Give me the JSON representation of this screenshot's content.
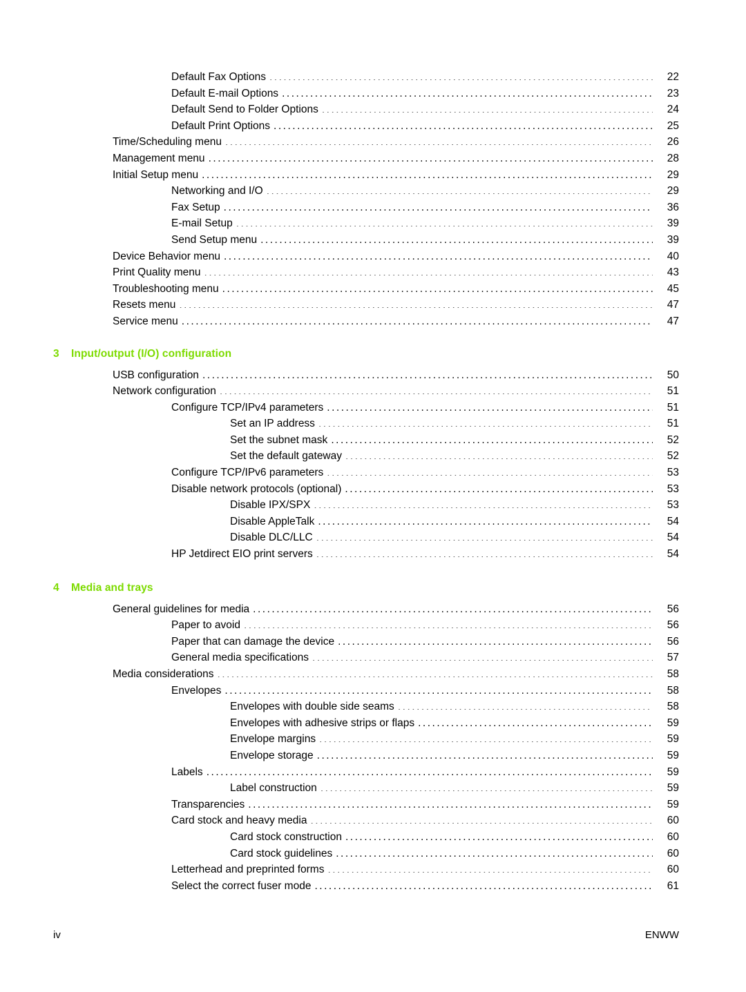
{
  "document": {
    "type": "table-of-contents",
    "accent_color": "#7ddb00",
    "text_color": "#000000",
    "background_color": "#ffffff"
  },
  "footer": {
    "page_label": "iv",
    "language_code": "ENWW"
  },
  "sections": [
    {
      "heading": null,
      "entries": [
        {
          "level": 2,
          "title": "Default Fax Options",
          "page": "22"
        },
        {
          "level": 2,
          "title": "Default E-mail Options",
          "page": "23"
        },
        {
          "level": 2,
          "title": "Default Send to Folder Options",
          "page": "24"
        },
        {
          "level": 2,
          "title": "Default Print Options",
          "page": "25"
        },
        {
          "level": 1,
          "title": "Time/Scheduling menu",
          "page": "26"
        },
        {
          "level": 1,
          "title": "Management menu",
          "page": "28"
        },
        {
          "level": 1,
          "title": "Initial Setup menu",
          "page": "29"
        },
        {
          "level": 2,
          "title": "Networking and I/O",
          "page": "29"
        },
        {
          "level": 2,
          "title": "Fax Setup",
          "page": "36"
        },
        {
          "level": 2,
          "title": "E-mail Setup",
          "page": "39"
        },
        {
          "level": 2,
          "title": "Send Setup menu",
          "page": "39"
        },
        {
          "level": 1,
          "title": "Device Behavior menu",
          "page": "40"
        },
        {
          "level": 1,
          "title": "Print Quality menu",
          "page": "43"
        },
        {
          "level": 1,
          "title": "Troubleshooting menu",
          "page": "45"
        },
        {
          "level": 1,
          "title": "Resets menu",
          "page": "47"
        },
        {
          "level": 1,
          "title": "Service menu",
          "page": "47"
        }
      ]
    },
    {
      "heading": {
        "number": "3",
        "title": "Input/output (I/O) configuration"
      },
      "entries": [
        {
          "level": 1,
          "title": "USB configuration",
          "page": "50"
        },
        {
          "level": 1,
          "title": "Network configuration",
          "page": "51"
        },
        {
          "level": 2,
          "title": "Configure TCP/IPv4 parameters",
          "page": "51"
        },
        {
          "level": 3,
          "title": "Set an IP address",
          "page": "51"
        },
        {
          "level": 3,
          "title": "Set the subnet mask",
          "page": "52"
        },
        {
          "level": 3,
          "title": "Set the default gateway",
          "page": "52"
        },
        {
          "level": 2,
          "title": "Configure TCP/IPv6 parameters",
          "page": "53"
        },
        {
          "level": 2,
          "title": "Disable network protocols (optional)",
          "page": "53"
        },
        {
          "level": 3,
          "title": "Disable IPX/SPX",
          "page": "53"
        },
        {
          "level": 3,
          "title": "Disable AppleTalk",
          "page": "54"
        },
        {
          "level": 3,
          "title": "Disable DLC/LLC",
          "page": "54"
        },
        {
          "level": 2,
          "title": "HP Jetdirect EIO print servers",
          "page": "54"
        }
      ]
    },
    {
      "heading": {
        "number": "4",
        "title": "Media and trays"
      },
      "entries": [
        {
          "level": 1,
          "title": "General guidelines for media",
          "page": "56"
        },
        {
          "level": 2,
          "title": "Paper to avoid",
          "page": "56"
        },
        {
          "level": 2,
          "title": "Paper that can damage the device",
          "page": "56"
        },
        {
          "level": 2,
          "title": "General media specifications",
          "page": "57"
        },
        {
          "level": 1,
          "title": "Media considerations",
          "page": "58"
        },
        {
          "level": 2,
          "title": "Envelopes",
          "page": "58"
        },
        {
          "level": 3,
          "title": "Envelopes with double side seams",
          "page": "58"
        },
        {
          "level": 3,
          "title": "Envelopes with adhesive strips or flaps",
          "page": "59"
        },
        {
          "level": 3,
          "title": "Envelope margins",
          "page": "59"
        },
        {
          "level": 3,
          "title": "Envelope storage",
          "page": "59"
        },
        {
          "level": 2,
          "title": "Labels",
          "page": "59"
        },
        {
          "level": 3,
          "title": "Label construction",
          "page": "59"
        },
        {
          "level": 2,
          "title": "Transparencies",
          "page": "59"
        },
        {
          "level": 2,
          "title": "Card stock and heavy media",
          "page": "60"
        },
        {
          "level": 3,
          "title": "Card stock construction",
          "page": "60"
        },
        {
          "level": 3,
          "title": "Card stock guidelines",
          "page": "60"
        },
        {
          "level": 2,
          "title": "Letterhead and preprinted forms",
          "page": "60"
        },
        {
          "level": 2,
          "title": "Select the correct fuser mode",
          "page": "61"
        }
      ]
    }
  ]
}
